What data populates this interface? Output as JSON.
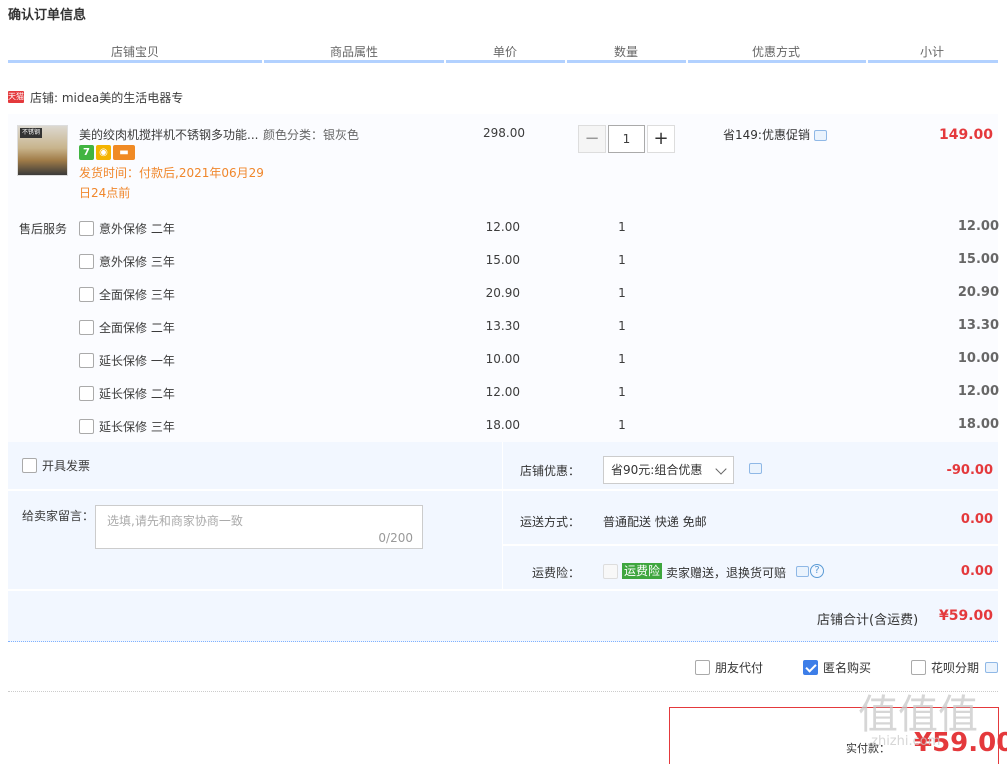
{
  "page_title": "确认订单信息",
  "columns": [
    "店铺宝贝",
    "商品属性",
    "单价",
    "数量",
    "优惠方式",
    "小计"
  ],
  "shop": {
    "badge": "天猫",
    "name": "店铺: midea美的生活电器专"
  },
  "product": {
    "thumb_label": "不锈钢",
    "name": "美的绞肉机搅拌机不锈钢多功能...",
    "badges": [
      {
        "text": "7",
        "color": "#41b441"
      },
      {
        "text": "◉",
        "color": "#f4b400"
      },
      {
        "text": "▬",
        "color": "#f08a24"
      }
    ],
    "ship_time": "发货时间：付款后,2021年06月29日24点前",
    "attribute": "颜色分类：银灰色",
    "price": "298.00",
    "qty_minus": "−",
    "qty": "1",
    "qty_plus": "+",
    "promo": "省149:优惠促销",
    "subtotal": "149.00"
  },
  "service_label": "售后服务",
  "services": [
    {
      "name": "意外保修 二年",
      "price": "12.00",
      "qty": "1",
      "subtotal": "12.00"
    },
    {
      "name": "意外保修 三年",
      "price": "15.00",
      "qty": "1",
      "subtotal": "15.00"
    },
    {
      "name": "全面保修 三年",
      "price": "20.90",
      "qty": "1",
      "subtotal": "20.90"
    },
    {
      "name": "全面保修 二年",
      "price": "13.30",
      "qty": "1",
      "subtotal": "13.30"
    },
    {
      "name": "延长保修 一年",
      "price": "10.00",
      "qty": "1",
      "subtotal": "10.00"
    },
    {
      "name": "延长保修 二年",
      "price": "12.00",
      "qty": "1",
      "subtotal": "12.00"
    },
    {
      "name": "延长保修 三年",
      "price": "18.00",
      "qty": "1",
      "subtotal": "18.00"
    }
  ],
  "invoice_label": "开具发票",
  "message": {
    "label": "给卖家留言：",
    "placeholder": "选填,请先和商家协商一致",
    "counter": "0/200"
  },
  "shop_discount": {
    "label": "店铺优惠：",
    "selected": "省90元:组合优惠",
    "value": "-90.00"
  },
  "shipping": {
    "label": "运送方式：",
    "text": "普通配送 快递 免邮",
    "value": "0.00"
  },
  "insurance": {
    "label": "运费险：",
    "tag": "运费险",
    "text": "卖家赠送，退换货可赔",
    "value": "0.00"
  },
  "shop_total": {
    "label": "店铺合计(含运费)",
    "value": "¥59.00"
  },
  "options": [
    {
      "label": "朋友代付",
      "checked": false
    },
    {
      "label": "匿名购买",
      "checked": true
    },
    {
      "label": "花呗分期",
      "checked": false
    }
  ],
  "payment": {
    "label": "实付款：",
    "value": "¥59.00"
  },
  "watermark": {
    "text": "值值值",
    "sub": ".zhizhi.com"
  },
  "colors": {
    "accent_red": "#e4393c",
    "header_line": "#b2d1ff",
    "panel_bg": "#f2f7ff",
    "ship_orange": "#f0872c",
    "checkbox_blue": "#3d7ee8"
  }
}
